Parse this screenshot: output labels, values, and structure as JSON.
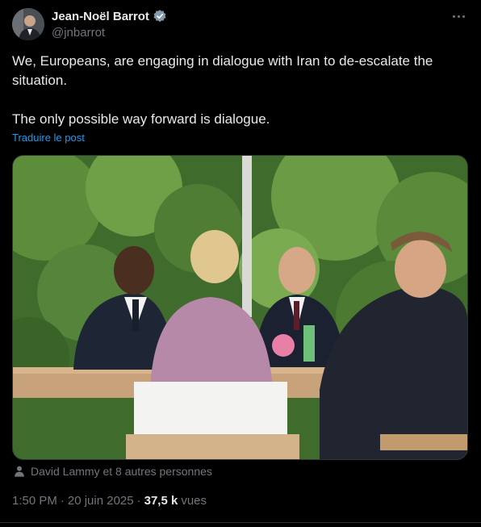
{
  "author": {
    "display_name": "Jean-Noël Barrot",
    "handle": "@jnbarrot",
    "verified_icon": "verified-badge-icon"
  },
  "tweet": {
    "paragraphs": [
      "We, Europeans, are engaging in dialogue with Iran to de-escalate the situation.",
      "The only possible way forward is dialogue."
    ],
    "translate_label": "Traduire le post"
  },
  "media": {
    "tagged_text": "David Lammy et 8 autres personnes"
  },
  "meta": {
    "time": "1:50 PM",
    "separator": "·",
    "date": "20 juin 2025",
    "views_count": "37,5 k",
    "views_label": "vues"
  },
  "colors": {
    "background": "#000000",
    "text": "#e7e9ea",
    "muted": "#71767b",
    "link": "#1d9bf0",
    "border": "#2f3336"
  }
}
